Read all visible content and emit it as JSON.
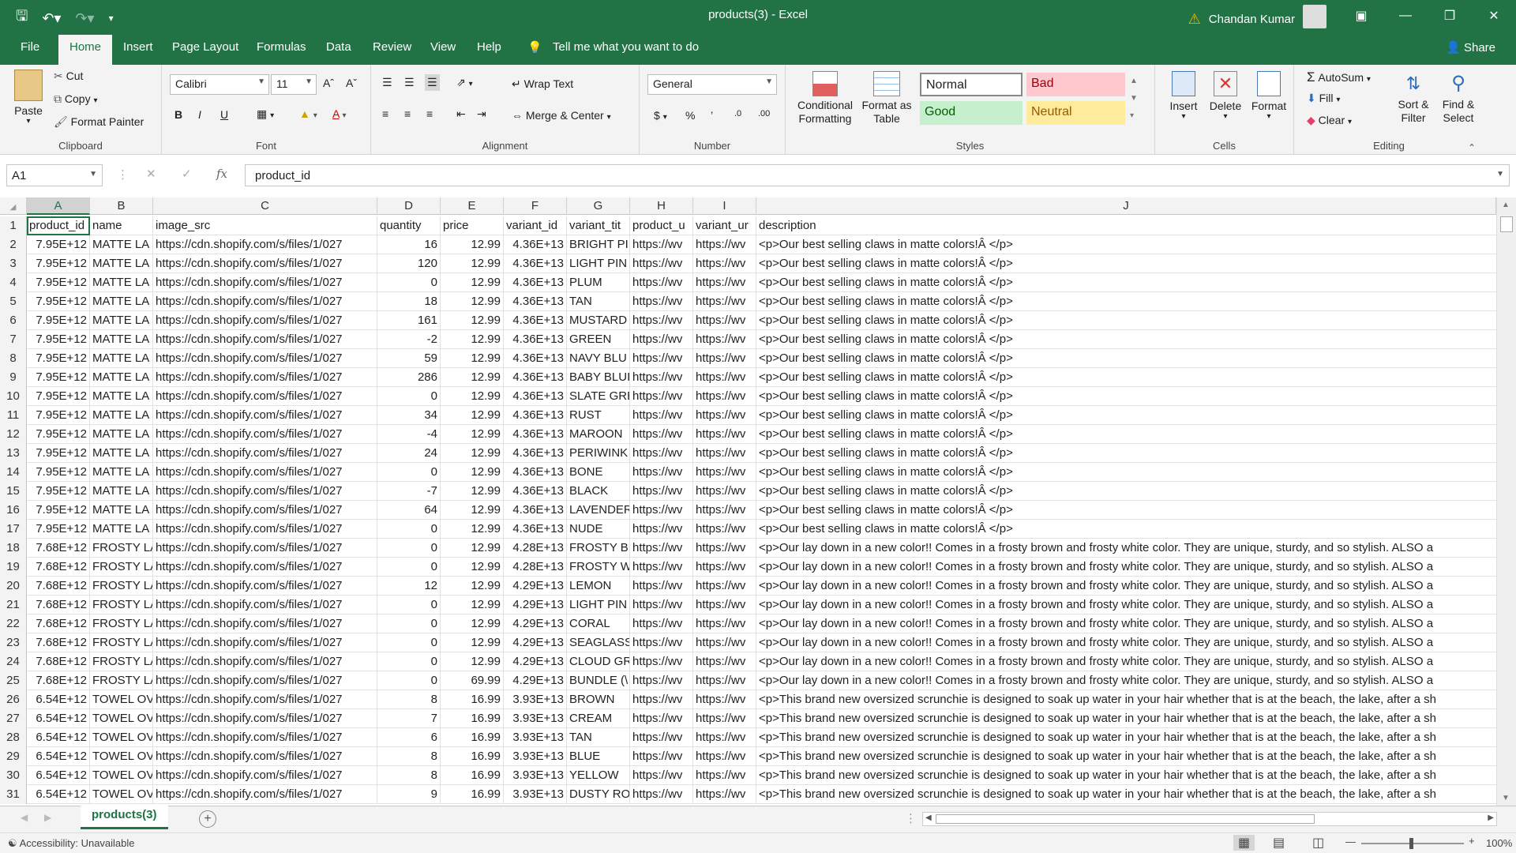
{
  "app": {
    "document_title": "products(3)",
    "app_name": "Excel",
    "title_text": "products(3) - Excel",
    "user_name": "Chandan Kumar"
  },
  "menu": {
    "tabs": [
      "File",
      "Home",
      "Insert",
      "Page Layout",
      "Formulas",
      "Data",
      "Review",
      "View",
      "Help"
    ],
    "active_tab": "Home",
    "tell_me": "Tell me what you want to do",
    "share": "Share"
  },
  "ribbon": {
    "clipboard": {
      "label": "Clipboard",
      "paste": "Paste",
      "cut": "Cut",
      "copy": "Copy",
      "format_painter": "Format Painter"
    },
    "font": {
      "label": "Font",
      "font_name": "Calibri",
      "font_size": "11",
      "bold": "B",
      "italic": "I",
      "underline": "U"
    },
    "alignment": {
      "label": "Alignment",
      "wrap_text": "Wrap Text",
      "merge_center": "Merge & Center"
    },
    "number": {
      "label": "Number",
      "format": "General"
    },
    "styles": {
      "label": "Styles",
      "conditional_formatting": "Conditional Formatting",
      "format_as_table": "Format as Table",
      "normal": "Normal",
      "bad": "Bad",
      "good": "Good",
      "neutral": "Neutral"
    },
    "cells": {
      "label": "Cells",
      "insert": "Insert",
      "delete": "Delete",
      "format": "Format"
    },
    "editing": {
      "label": "Editing",
      "autosum": "AutoSum",
      "fill": "Fill",
      "clear": "Clear",
      "sort_filter": "Sort & Filter",
      "find_select": "Find & Select"
    }
  },
  "formula_bar": {
    "name_box": "A1",
    "fx": "fx",
    "content": "product_id"
  },
  "columns": [
    "A",
    "B",
    "C",
    "D",
    "E",
    "F",
    "G",
    "H",
    "I",
    "J"
  ],
  "header_row": [
    "product_id",
    "name",
    "image_src",
    "quantity",
    "price",
    "variant_id",
    "variant_tit",
    "product_u",
    "variant_ur",
    "description"
  ],
  "rows": [
    [
      "7.95E+12",
      "MATTE LA",
      "https://cdn.shopify.com/s/files/1/027",
      "16",
      "12.99",
      "4.36E+13",
      "BRIGHT PI",
      "https://wv",
      "https://wv",
      "<p>Our best selling claws in matte colors!Â </p>"
    ],
    [
      "7.95E+12",
      "MATTE LA",
      "https://cdn.shopify.com/s/files/1/027",
      "120",
      "12.99",
      "4.36E+13",
      "LIGHT PIN",
      "https://wv",
      "https://wv",
      "<p>Our best selling claws in matte colors!Â </p>"
    ],
    [
      "7.95E+12",
      "MATTE LA",
      "https://cdn.shopify.com/s/files/1/027",
      "0",
      "12.99",
      "4.36E+13",
      "PLUM",
      "https://wv",
      "https://wv",
      "<p>Our best selling claws in matte colors!Â </p>"
    ],
    [
      "7.95E+12",
      "MATTE LA",
      "https://cdn.shopify.com/s/files/1/027",
      "18",
      "12.99",
      "4.36E+13",
      "TAN",
      "https://wv",
      "https://wv",
      "<p>Our best selling claws in matte colors!Â </p>"
    ],
    [
      "7.95E+12",
      "MATTE LA",
      "https://cdn.shopify.com/s/files/1/027",
      "161",
      "12.99",
      "4.36E+13",
      "MUSTARD",
      "https://wv",
      "https://wv",
      "<p>Our best selling claws in matte colors!Â </p>"
    ],
    [
      "7.95E+12",
      "MATTE LA",
      "https://cdn.shopify.com/s/files/1/027",
      "-2",
      "12.99",
      "4.36E+13",
      "GREEN",
      "https://wv",
      "https://wv",
      "<p>Our best selling claws in matte colors!Â </p>"
    ],
    [
      "7.95E+12",
      "MATTE LA",
      "https://cdn.shopify.com/s/files/1/027",
      "59",
      "12.99",
      "4.36E+13",
      "NAVY BLU",
      "https://wv",
      "https://wv",
      "<p>Our best selling claws in matte colors!Â </p>"
    ],
    [
      "7.95E+12",
      "MATTE LA",
      "https://cdn.shopify.com/s/files/1/027",
      "286",
      "12.99",
      "4.36E+13",
      "BABY BLUI",
      "https://wv",
      "https://wv",
      "<p>Our best selling claws in matte colors!Â </p>"
    ],
    [
      "7.95E+12",
      "MATTE LA",
      "https://cdn.shopify.com/s/files/1/027",
      "0",
      "12.99",
      "4.36E+13",
      "SLATE GRE",
      "https://wv",
      "https://wv",
      "<p>Our best selling claws in matte colors!Â </p>"
    ],
    [
      "7.95E+12",
      "MATTE LA",
      "https://cdn.shopify.com/s/files/1/027",
      "34",
      "12.99",
      "4.36E+13",
      "RUST",
      "https://wv",
      "https://wv",
      "<p>Our best selling claws in matte colors!Â </p>"
    ],
    [
      "7.95E+12",
      "MATTE LA",
      "https://cdn.shopify.com/s/files/1/027",
      "-4",
      "12.99",
      "4.36E+13",
      "MAROON",
      "https://wv",
      "https://wv",
      "<p>Our best selling claws in matte colors!Â </p>"
    ],
    [
      "7.95E+12",
      "MATTE LA",
      "https://cdn.shopify.com/s/files/1/027",
      "24",
      "12.99",
      "4.36E+13",
      "PERIWINK",
      "https://wv",
      "https://wv",
      "<p>Our best selling claws in matte colors!Â </p>"
    ],
    [
      "7.95E+12",
      "MATTE LA",
      "https://cdn.shopify.com/s/files/1/027",
      "0",
      "12.99",
      "4.36E+13",
      "BONE",
      "https://wv",
      "https://wv",
      "<p>Our best selling claws in matte colors!Â </p>"
    ],
    [
      "7.95E+12",
      "MATTE LA",
      "https://cdn.shopify.com/s/files/1/027",
      "-7",
      "12.99",
      "4.36E+13",
      "BLACK",
      "https://wv",
      "https://wv",
      "<p>Our best selling claws in matte colors!Â </p>"
    ],
    [
      "7.95E+12",
      "MATTE LA",
      "https://cdn.shopify.com/s/files/1/027",
      "64",
      "12.99",
      "4.36E+13",
      "LAVENDER",
      "https://wv",
      "https://wv",
      "<p>Our best selling claws in matte colors!Â </p>"
    ],
    [
      "7.95E+12",
      "MATTE LA",
      "https://cdn.shopify.com/s/files/1/027",
      "0",
      "12.99",
      "4.36E+13",
      "NUDE",
      "https://wv",
      "https://wv",
      "<p>Our best selling claws in matte colors!Â </p>"
    ],
    [
      "7.68E+12",
      "FROSTY LA",
      "https://cdn.shopify.com/s/files/1/027",
      "0",
      "12.99",
      "4.28E+13",
      "FROSTY BF",
      "https://wv",
      "https://wv",
      "<p>Our lay down in a new color!! Comes in a frosty brown and frosty white color. They are unique, sturdy, and so stylish. ALSO a"
    ],
    [
      "7.68E+12",
      "FROSTY LA",
      "https://cdn.shopify.com/s/files/1/027",
      "0",
      "12.99",
      "4.28E+13",
      "FROSTY W",
      "https://wv",
      "https://wv",
      "<p>Our lay down in a new color!! Comes in a frosty brown and frosty white color. They are unique, sturdy, and so stylish. ALSO a"
    ],
    [
      "7.68E+12",
      "FROSTY LA",
      "https://cdn.shopify.com/s/files/1/027",
      "12",
      "12.99",
      "4.29E+13",
      "LEMON",
      "https://wv",
      "https://wv",
      "<p>Our lay down in a new color!! Comes in a frosty brown and frosty white color. They are unique, sturdy, and so stylish. ALSO a"
    ],
    [
      "7.68E+12",
      "FROSTY LA",
      "https://cdn.shopify.com/s/files/1/027",
      "0",
      "12.99",
      "4.29E+13",
      "LIGHT PIN",
      "https://wv",
      "https://wv",
      "<p>Our lay down in a new color!! Comes in a frosty brown and frosty white color. They are unique, sturdy, and so stylish. ALSO a"
    ],
    [
      "7.68E+12",
      "FROSTY LA",
      "https://cdn.shopify.com/s/files/1/027",
      "0",
      "12.99",
      "4.29E+13",
      "CORAL",
      "https://wv",
      "https://wv",
      "<p>Our lay down in a new color!! Comes in a frosty brown and frosty white color. They are unique, sturdy, and so stylish. ALSO a"
    ],
    [
      "7.68E+12",
      "FROSTY LA",
      "https://cdn.shopify.com/s/files/1/027",
      "0",
      "12.99",
      "4.29E+13",
      "SEAGLASS",
      "https://wv",
      "https://wv",
      "<p>Our lay down in a new color!! Comes in a frosty brown and frosty white color. They are unique, sturdy, and so stylish. ALSO a"
    ],
    [
      "7.68E+12",
      "FROSTY LA",
      "https://cdn.shopify.com/s/files/1/027",
      "0",
      "12.99",
      "4.29E+13",
      "CLOUD GR",
      "https://wv",
      "https://wv",
      "<p>Our lay down in a new color!! Comes in a frosty brown and frosty white color. They are unique, sturdy, and so stylish. ALSO a"
    ],
    [
      "7.68E+12",
      "FROSTY LA",
      "https://cdn.shopify.com/s/files/1/027",
      "0",
      "69.99",
      "4.29E+13",
      "BUNDLE (\\",
      "https://wv",
      "https://wv",
      "<p>Our lay down in a new color!! Comes in a frosty brown and frosty white color. They are unique, sturdy, and so stylish. ALSO a"
    ],
    [
      "6.54E+12",
      "TOWEL OV",
      "https://cdn.shopify.com/s/files/1/027",
      "8",
      "16.99",
      "3.93E+13",
      "BROWN",
      "https://wv",
      "https://wv",
      "<p>This brand new oversized scrunchie is designed to soak up water in your hair whether that is at the beach, the lake, after a sh"
    ],
    [
      "6.54E+12",
      "TOWEL OV",
      "https://cdn.shopify.com/s/files/1/027",
      "7",
      "16.99",
      "3.93E+13",
      "CREAM",
      "https://wv",
      "https://wv",
      "<p>This brand new oversized scrunchie is designed to soak up water in your hair whether that is at the beach, the lake, after a sh"
    ],
    [
      "6.54E+12",
      "TOWEL OV",
      "https://cdn.shopify.com/s/files/1/027",
      "6",
      "16.99",
      "3.93E+13",
      "TAN",
      "https://wv",
      "https://wv",
      "<p>This brand new oversized scrunchie is designed to soak up water in your hair whether that is at the beach, the lake, after a sh"
    ],
    [
      "6.54E+12",
      "TOWEL OV",
      "https://cdn.shopify.com/s/files/1/027",
      "8",
      "16.99",
      "3.93E+13",
      "BLUE",
      "https://wv",
      "https://wv",
      "<p>This brand new oversized scrunchie is designed to soak up water in your hair whether that is at the beach, the lake, after a sh"
    ],
    [
      "6.54E+12",
      "TOWEL OV",
      "https://cdn.shopify.com/s/files/1/027",
      "8",
      "16.99",
      "3.93E+13",
      "YELLOW",
      "https://wv",
      "https://wv",
      "<p>This brand new oversized scrunchie is designed to soak up water in your hair whether that is at the beach, the lake, after a sh"
    ],
    [
      "6.54E+12",
      "TOWEL OV",
      "https://cdn.shopify.com/s/files/1/027",
      "9",
      "16.99",
      "3.93E+13",
      "DUSTY RO",
      "https://wv",
      "https://wv",
      "<p>This brand new oversized scrunchie is designed to soak up water in your hair whether that is at the beach, the lake, after a sh"
    ]
  ],
  "sheet_tabs": [
    "products(3)"
  ],
  "status": {
    "accessibility": "Accessibility: Unavailable",
    "zoom": "100%"
  },
  "colors": {
    "accent": "#217346",
    "ribbon_bg": "#f3f3f3",
    "bad_bg": "#ffc7ce",
    "bad_fg": "#9c0006",
    "good_bg": "#c6efce",
    "good_fg": "#006100",
    "neutral_bg": "#ffeb9c",
    "neutral_fg": "#9c5700"
  }
}
